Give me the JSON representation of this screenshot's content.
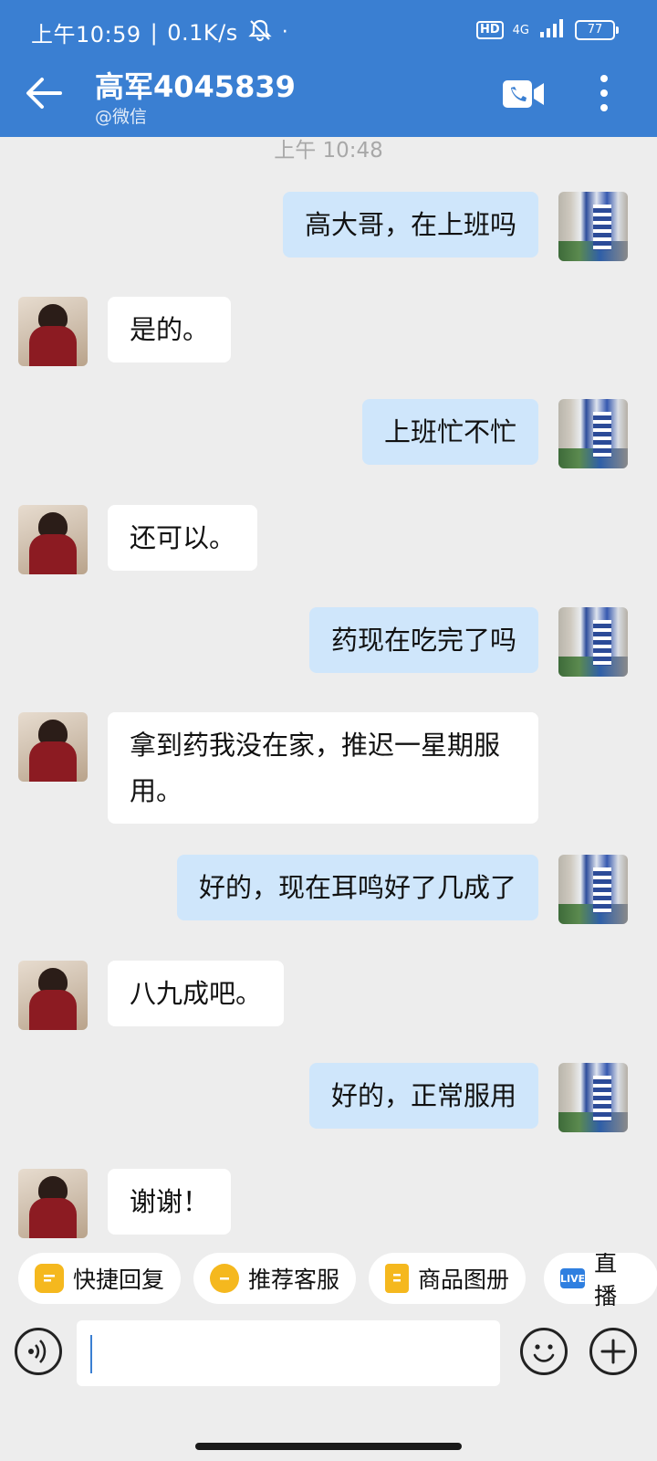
{
  "status_bar": {
    "time": "上午10:59",
    "net_speed": "0.1K/s",
    "hd_label": "HD",
    "network_label": "4G",
    "battery": "77"
  },
  "header": {
    "title": "高军4045839",
    "subtitle": "@微信",
    "icons": {
      "back": "back-arrow-icon",
      "video_call": "video-call-icon",
      "more": "more-vertical-icon"
    }
  },
  "chat": {
    "timestamp": "上午 10:48",
    "messages": [
      {
        "from": "me",
        "text": "高大哥，在上班吗"
      },
      {
        "from": "other",
        "text": "是的。"
      },
      {
        "from": "me",
        "text": "上班忙不忙"
      },
      {
        "from": "other",
        "text": "还可以。"
      },
      {
        "from": "me",
        "text": "药现在吃完了吗"
      },
      {
        "from": "other",
        "text": "拿到药我没在家，推迟一星期服用。"
      },
      {
        "from": "me",
        "text": "好的，现在耳鸣好了几成了"
      },
      {
        "from": "other",
        "text": "八九成吧。"
      },
      {
        "from": "me",
        "text": "好的，正常服用"
      },
      {
        "from": "other",
        "text": "谢谢！"
      }
    ]
  },
  "quick_actions": [
    {
      "label": "快捷回复",
      "icon": "quick-reply-icon"
    },
    {
      "label": "推荐客服",
      "icon": "recommend-service-icon"
    },
    {
      "label": "商品图册",
      "icon": "product-album-icon"
    },
    {
      "label": "直播",
      "icon": "live-icon",
      "badge": "LIVE"
    }
  ],
  "input": {
    "value": "",
    "icons": {
      "voice": "voice-icon",
      "emoji": "emoji-icon",
      "add": "plus-icon"
    }
  },
  "colors": {
    "header_bg": "#3a7fd2",
    "chat_bg": "#ededed",
    "my_bubble": "#cfe6fb",
    "other_bubble": "#ffffff",
    "chip_icon": "#f5b81e"
  }
}
